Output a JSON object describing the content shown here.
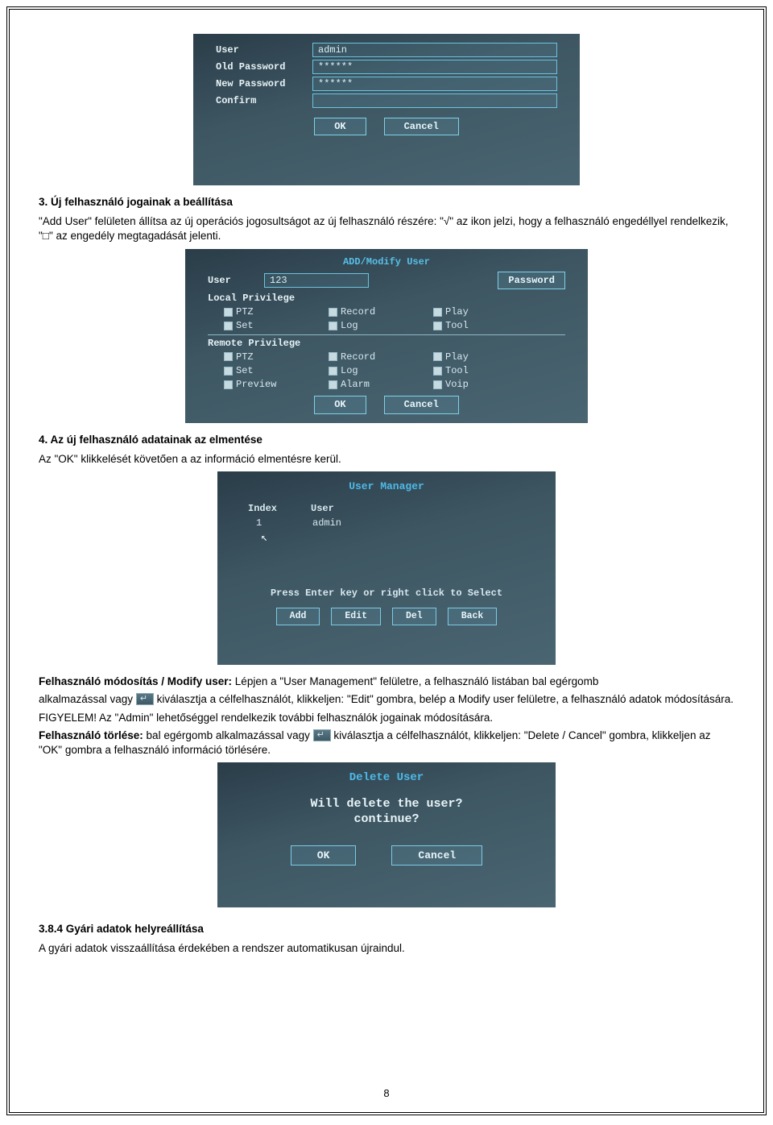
{
  "sections": {
    "s3_title": "3. Új felhasználó jogainak a beállítása",
    "s3_body": "\"Add User\" felületen állítsa az új operációs jogosultságot az új felhasználó részére: \"√\" az ikon jelzi, hogy a felhasználó engedéllyel rendelkezik, \"□\" az engedély megtagadását jelenti.",
    "s4_title": "4. Az új felhasználó adatainak az elmentése",
    "s4_body": "Az \"OK\" klikkelését követően a az információ elmentésre kerül.",
    "modify_lead_bold": "Felhasználó módosítás / Modify user:",
    "modify_lead_rest": " Lépjen a \"User Management\" felületre, a felhasználó listában bal egérgomb",
    "modify_line2_a": "alkalmazással vagy ",
    "modify_line2_b": " kiválasztja a célfelhasználót, klikkeljen: \"Edit\" gombra, belép a Modify user felületre, a felhasználó adatok módosítására.",
    "modify_line3": "FIGYELEM! Az \"Admin\" lehetőséggel rendelkezik további felhasználók jogainak módosítására.",
    "delete_lead_bold": "Felhasználó törlése:",
    "delete_lead_a": " bal egérgomb alkalmazással vagy ",
    "delete_lead_b": " kiválasztja a célfelhasználót, klikkeljen: \"Delete / Cancel\" gombra, klikkeljen az \"OK\" gombra a felhasználó információ törlésére.",
    "s384_title": "3.8.4 Gyári adatok helyreállítása",
    "s384_body": "A gyári adatok visszaállítása érdekében a rendszer automatikusan újraindul."
  },
  "shot1": {
    "labels": {
      "user": "User",
      "oldpw": "Old Password",
      "newpw": "New Password",
      "confirm": "Confirm"
    },
    "values": {
      "user": "admin",
      "oldpw": "******",
      "newpw": "******",
      "confirm": ""
    },
    "btn_ok": "OK",
    "btn_cancel": "Cancel"
  },
  "shot2": {
    "title": "ADD/Modify User",
    "user_label": "User",
    "user_value": "123",
    "pw_btn": "Password",
    "local_title": "Local Privilege",
    "remote_title": "Remote Privilege",
    "items_local": [
      "PTZ",
      "Record",
      "Play",
      "Set",
      "Log",
      "Tool"
    ],
    "items_remote": [
      "PTZ",
      "Record",
      "Play",
      "Set",
      "Log",
      "Tool",
      "Preview",
      "Alarm",
      "Voip"
    ],
    "btn_ok": "OK",
    "btn_cancel": "Cancel"
  },
  "shot3": {
    "title": "User Manager",
    "col_index": "Index",
    "col_user": "User",
    "row_idx": "1",
    "row_user": "admin",
    "hint": "Press Enter key or right click to Select",
    "btn_add": "Add",
    "btn_edit": "Edit",
    "btn_del": "Del",
    "btn_back": "Back"
  },
  "shot4": {
    "title": "Delete User",
    "msg1": "Will delete the user?",
    "msg2": "continue?",
    "btn_ok": "OK",
    "btn_cancel": "Cancel"
  },
  "page_number": "8"
}
